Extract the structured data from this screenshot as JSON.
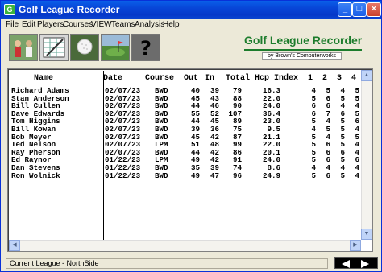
{
  "window": {
    "title": "Golf League Recorder"
  },
  "menu": [
    "File",
    "Edit",
    "Players",
    "Courses",
    "VIEW",
    "Teams",
    "Analysis",
    "Help"
  ],
  "toolbar": {
    "buttons": [
      {
        "name": "players-icon"
      },
      {
        "name": "scorecard-icon"
      },
      {
        "name": "golfball-icon"
      },
      {
        "name": "course-icon"
      },
      {
        "name": "help-icon"
      }
    ]
  },
  "logo": {
    "title": "Golf League Recorder",
    "subtitle": "by Brown's Computerworks"
  },
  "grid": {
    "headers": [
      "Name",
      "Date",
      "Course",
      "Out",
      "In",
      "Total",
      "Hcp Index",
      "1",
      "2",
      "3",
      "4"
    ],
    "rows": [
      [
        "Richard Adams",
        "02/07/23",
        "BWD",
        "40",
        "39",
        "79",
        "16.3",
        "4",
        "5",
        "4",
        "5"
      ],
      [
        "Stan Anderson",
        "02/07/23",
        "BWD",
        "45",
        "43",
        "88",
        "22.0",
        "5",
        "6",
        "5",
        "5"
      ],
      [
        "Bill Cullen",
        "02/07/23",
        "BWD",
        "44",
        "46",
        "90",
        "24.0",
        "6",
        "6",
        "4",
        "4"
      ],
      [
        "Dave Edwards",
        "02/07/23",
        "BWD",
        "55",
        "52",
        "107",
        "36.4",
        "6",
        "7",
        "6",
        "5"
      ],
      [
        "Tom Higgins",
        "02/07/23",
        "BWD",
        "44",
        "45",
        "89",
        "23.0",
        "5",
        "4",
        "5",
        "6"
      ],
      [
        "Bill Kowan",
        "02/07/23",
        "BWD",
        "39",
        "36",
        "75",
        "9.5",
        "4",
        "5",
        "5",
        "4"
      ],
      [
        "Bob Meyer",
        "02/07/23",
        "BWD",
        "45",
        "42",
        "87",
        "21.1",
        "5",
        "4",
        "5",
        "5"
      ],
      [
        "Ted Nelson",
        "02/07/23",
        "LPM",
        "51",
        "48",
        "99",
        "22.0",
        "5",
        "6",
        "5",
        "4"
      ],
      [
        "Ray Pherson",
        "02/07/23",
        "BWD",
        "44",
        "42",
        "86",
        "20.1",
        "5",
        "6",
        "6",
        "4"
      ],
      [
        "Ed Raynor",
        "01/22/23",
        "LPM",
        "49",
        "42",
        "91",
        "24.0",
        "5",
        "6",
        "5",
        "6"
      ],
      [
        "Dan Stevens",
        "01/22/23",
        "BWD",
        "35",
        "39",
        "74",
        "8.6",
        "4",
        "4",
        "4",
        "4"
      ],
      [
        "Ron Wolnick",
        "01/22/23",
        "BWD",
        "49",
        "47",
        "96",
        "24.9",
        "5",
        "6",
        "5",
        "4"
      ]
    ]
  },
  "status": {
    "text": "Current League - NorthSide"
  }
}
